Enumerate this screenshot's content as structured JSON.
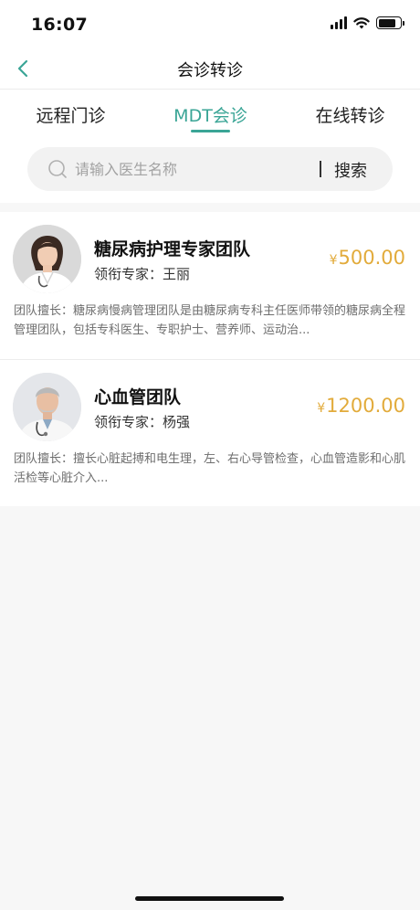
{
  "status_bar": {
    "time": "16:07"
  },
  "nav": {
    "title": "会诊转诊"
  },
  "tabs": [
    {
      "label": "远程门诊"
    },
    {
      "label": "MDT会诊"
    },
    {
      "label": "在线转诊"
    }
  ],
  "search": {
    "placeholder": "请输入医生名称",
    "value": "",
    "button_label": "搜索"
  },
  "teams": [
    {
      "name": "糖尿病护理专家团队",
      "lead": "领衔专家：王丽",
      "price_symbol": "¥",
      "price": "500.00",
      "description": "团队擅长：糖尿病慢病管理团队是由糖尿病专科主任医师带领的糖尿病全程管理团队，包括专科医生、专职护士、营养师、运动治..."
    },
    {
      "name": "心血管团队",
      "lead": "领衔专家：杨强",
      "price_symbol": "¥",
      "price": "1200.00",
      "description": "团队擅长：擅长心脏起搏和电生理，左、右心导管检查，心血管造影和心肌活检等心脏介入..."
    }
  ],
  "colors": {
    "accent": "#3aa596",
    "price": "#e2ab3b"
  }
}
